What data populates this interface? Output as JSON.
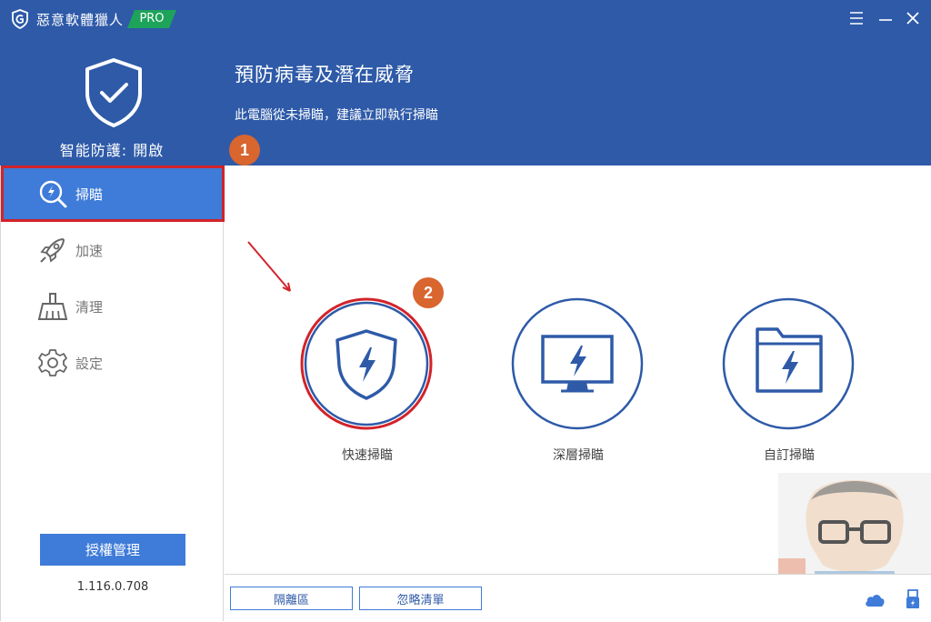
{
  "app": {
    "title": "惡意軟體獵人",
    "badge": "PRO",
    "version": "1.116.0.708"
  },
  "window_controls": {
    "menu_icon": "hamburger-menu-icon",
    "minimize_icon": "minimize-icon",
    "close_icon": "close-icon"
  },
  "protection": {
    "label": "智能防護: 開啟",
    "icon": "shield-check-icon"
  },
  "header": {
    "headline": "預防病毒及潛在威脅",
    "subline": "此電腦從未掃瞄，建議立即執行掃瞄"
  },
  "annotations": {
    "step1": "1",
    "step2": "2"
  },
  "sidebar": {
    "items": [
      {
        "label": "掃瞄",
        "icon": "scan-magnifier-icon",
        "active": true
      },
      {
        "label": "加速",
        "icon": "rocket-icon",
        "active": false
      },
      {
        "label": "清理",
        "icon": "broom-icon",
        "active": false
      },
      {
        "label": "設定",
        "icon": "gear-icon",
        "active": false
      }
    ],
    "license_button": "授權管理"
  },
  "scan_options": [
    {
      "label": "快速掃瞄",
      "icon": "shield-bolt-icon"
    },
    {
      "label": "深層掃瞄",
      "icon": "monitor-bolt-icon"
    },
    {
      "label": "自訂掃瞄",
      "icon": "folder-bolt-icon"
    }
  ],
  "bottom_bar": {
    "quarantine": "隔離區",
    "ignore_list": "忽略清單"
  },
  "colors": {
    "header_blue": "#2e5aa8",
    "accent_blue": "#3f7bd8",
    "pro_green": "#1ea35a",
    "annotation_red": "#d2232a",
    "badge_orange": "#d9652f"
  }
}
